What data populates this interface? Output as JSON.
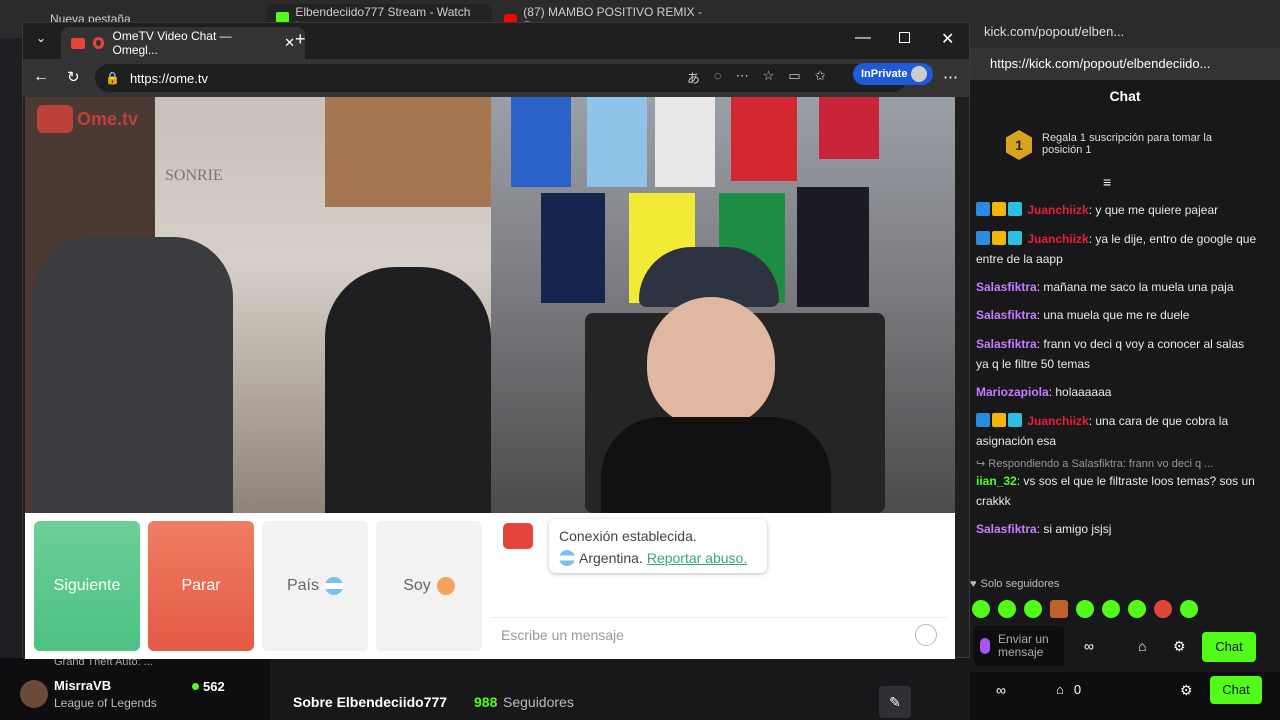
{
  "bg_tabs": [
    {
      "label": "Nueva pestaña"
    },
    {
      "label": "Elbendeciido777 Stream - Watch L..."
    },
    {
      "label": "(87) MAMBO POSITIVO REMIX - R..."
    }
  ],
  "window": {
    "tab_title": "OmeTV Video Chat — Omegl...",
    "url": "https://ome.tv",
    "inprivate_label": "InPrivate"
  },
  "ometv": {
    "logo_text": "Ome.tv",
    "buttons": {
      "next": "Siguiente",
      "stop": "Parar",
      "country": "País",
      "gender": "Soy"
    },
    "status": {
      "line1": "Conexión establecida.",
      "country": "Argentina.",
      "report": "Reportar abuso."
    },
    "message_placeholder": "Escribe un mensaje"
  },
  "kick": {
    "url_short": "kick.com/popout/elben...",
    "url": "https://kick.com/popout/elbendeciido...",
    "chat_title": "Chat",
    "gift_text": "Regala 1 suscripción para tomar la posición 1",
    "gift_rank": "1",
    "messages": [
      {
        "user": "Juanchiizk",
        "text": ": y que me quiere pajear",
        "color": "#e91e3a",
        "badges": true
      },
      {
        "user": "Juanchiizk",
        "text": ": ya le dije, entro de google que entre de la aapp",
        "color": "#e91e3a",
        "badges": true
      },
      {
        "user": "Salasfiktra",
        "text": ": mañana me saco la muela una paja",
        "color": "#c77dff",
        "badges": false
      },
      {
        "user": "Salasfiktra",
        "text": ": una muela que me re duele",
        "color": "#c77dff",
        "badges": false
      },
      {
        "user": "Salasfiktra",
        "text": ": frann vo deci q voy a conocer al salas ya q le filtre 50 temas",
        "color": "#c77dff",
        "badges": false
      },
      {
        "user": "Mariozapiola",
        "text": ": holaaaaaa",
        "color": "#c77dff",
        "badges": false
      },
      {
        "user": "Juanchiizk",
        "text": ": una cara de que cobra la asignación esa",
        "color": "#e91e3a",
        "badges": true
      }
    ],
    "reply": {
      "ref": "Respondiendo a Salasfiktra: frann vo deci q ...",
      "user": "iian_32",
      "text": ": vs sos el que le filtraste loos temas? sos un crakkk",
      "color": "#53fc18"
    },
    "last": {
      "user": "Salasfiktra",
      "text": ": si amigo jsjsj",
      "color": "#c77dff"
    },
    "followers_only": "Solo seguidores",
    "input_placeholder": "Enviar un mensaje",
    "chat_button": "Chat",
    "bottom_count": "0",
    "bottom_chat": "Chat"
  },
  "bottom": {
    "game_partial": "Grand Theft Auto: ...",
    "streamer": "MisrraVB",
    "streamer_game": "League of Legends",
    "viewers": "562",
    "about": "Sobre Elbendeciido777",
    "followers_count": "988",
    "followers_label": "Seguidores"
  }
}
